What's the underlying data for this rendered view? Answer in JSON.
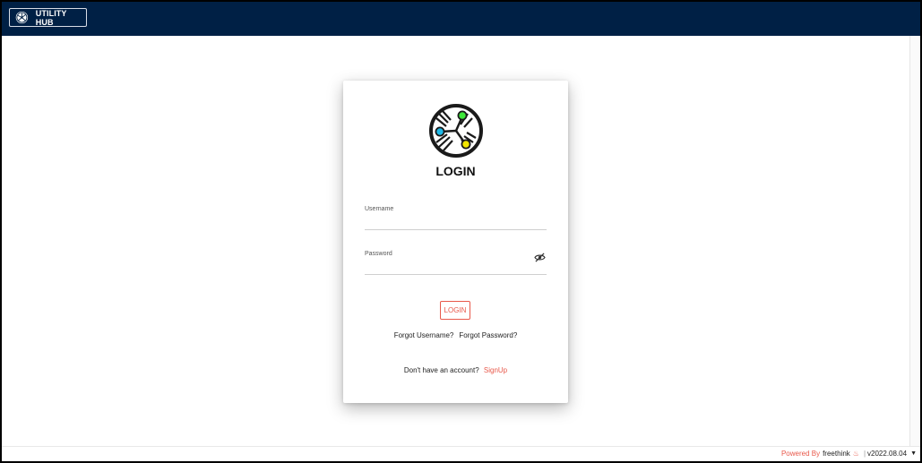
{
  "header": {
    "brand_label": "UTILITY HUB",
    "brand_icon": "utility-hub-logo-icon",
    "background": "#002045"
  },
  "login_card": {
    "logo_icon": "utility-hub-logo-icon",
    "title": "LOGIN",
    "username_label": "Username",
    "username_value": "",
    "password_label": "Password",
    "password_value": "",
    "password_visibility_icon": "eye-off-icon",
    "login_button": "LOGIN",
    "forgot_username": "Forgot Username?",
    "forgot_password": "Forgot Password?",
    "no_account_text": "Don't have an account?",
    "signup_link": "SignUp"
  },
  "footer": {
    "powered_by": "Powered By",
    "company": "freethink",
    "version": "v2022.08.04"
  },
  "colors": {
    "accent": "#e8584a",
    "header_bg": "#002045",
    "logo_green": "#3ee83a",
    "logo_cyan": "#1fb9e8",
    "logo_yellow": "#f2e600"
  }
}
